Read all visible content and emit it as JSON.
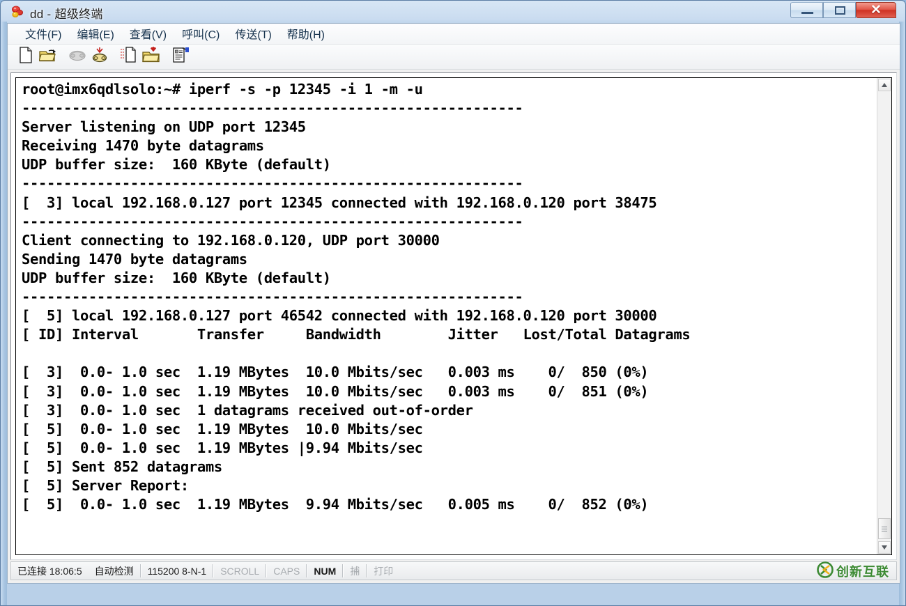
{
  "window": {
    "title": "dd - 超级终端",
    "icon": "hyperterminal-icon",
    "buttons": {
      "minimize": "—",
      "maximize": "❐",
      "close": "✕"
    }
  },
  "menu": [
    {
      "label": "文件(F)",
      "mnemonic": "F"
    },
    {
      "label": "编辑(E)",
      "mnemonic": "E"
    },
    {
      "label": "查看(V)",
      "mnemonic": "V"
    },
    {
      "label": "呼叫(C)",
      "mnemonic": "C"
    },
    {
      "label": "传送(T)",
      "mnemonic": "T"
    },
    {
      "label": "帮助(H)",
      "mnemonic": "H"
    }
  ],
  "toolbar": {
    "items": [
      {
        "name": "new-connection-icon",
        "tooltip": "新建"
      },
      {
        "name": "open-folder-icon",
        "tooltip": "打开"
      },
      {
        "name": "call-icon",
        "tooltip": "呼叫"
      },
      {
        "name": "disconnect-icon",
        "tooltip": "断开"
      },
      {
        "name": "send-file-icon",
        "tooltip": "发送文件"
      },
      {
        "name": "receive-file-icon",
        "tooltip": "接收文件"
      },
      {
        "name": "properties-icon",
        "tooltip": "属性"
      }
    ]
  },
  "terminal": {
    "lines": [
      "root@imx6qdlsolo:~# iperf -s -p 12345 -i 1 -m -u",
      "------------------------------------------------------------",
      "Server listening on UDP port 12345",
      "Receiving 1470 byte datagrams",
      "UDP buffer size:  160 KByte (default)",
      "------------------------------------------------------------",
      "[  3] local 192.168.0.127 port 12345 connected with 192.168.0.120 port 38475",
      "------------------------------------------------------------",
      "Client connecting to 192.168.0.120, UDP port 30000",
      "Sending 1470 byte datagrams",
      "UDP buffer size:  160 KByte (default)",
      "------------------------------------------------------------",
      "[  5] local 192.168.0.127 port 46542 connected with 192.168.0.120 port 30000",
      "[ ID] Interval       Transfer     Bandwidth        Jitter   Lost/Total Datagrams",
      "",
      "[  3]  0.0- 1.0 sec  1.19 MBytes  10.0 Mbits/sec   0.003 ms    0/  850 (0%)",
      "[  3]  0.0- 1.0 sec  1.19 MBytes  10.0 Mbits/sec   0.003 ms    0/  851 (0%)",
      "[  3]  0.0- 1.0 sec  1 datagrams received out-of-order",
      "[  5]  0.0- 1.0 sec  1.19 MBytes  10.0 Mbits/sec",
      "[  5]  0.0- 1.0 sec  1.19 MBytes |9.94 Mbits/sec",
      "[  5] Sent 852 datagrams",
      "[  5] Server Report:",
      "[  5]  0.0- 1.0 sec  1.19 MBytes  9.94 Mbits/sec   0.005 ms    0/  852 (0%)"
    ],
    "scrollbar": {
      "up_arrow": "▲",
      "down_arrow": "▼",
      "position": "bottom"
    }
  },
  "status_bar": {
    "connected": "已连接 18:06:5",
    "detect": "自动检测",
    "port_settings": "115200 8-N-1",
    "scroll": "SCROLL",
    "caps": "CAPS",
    "num": "NUM",
    "capture": "捕",
    "print": "打印"
  },
  "watermark": {
    "text": "创新互联",
    "logo": "cx-logo-icon"
  },
  "colors": {
    "title_bar_top": "#d7e6f5",
    "close_button": "#cf3224",
    "terminal_bg": "#ffffff",
    "terminal_fg": "#000000",
    "watermark_green": "#3c8a33",
    "watermark_yellow": "#f2b21c"
  }
}
